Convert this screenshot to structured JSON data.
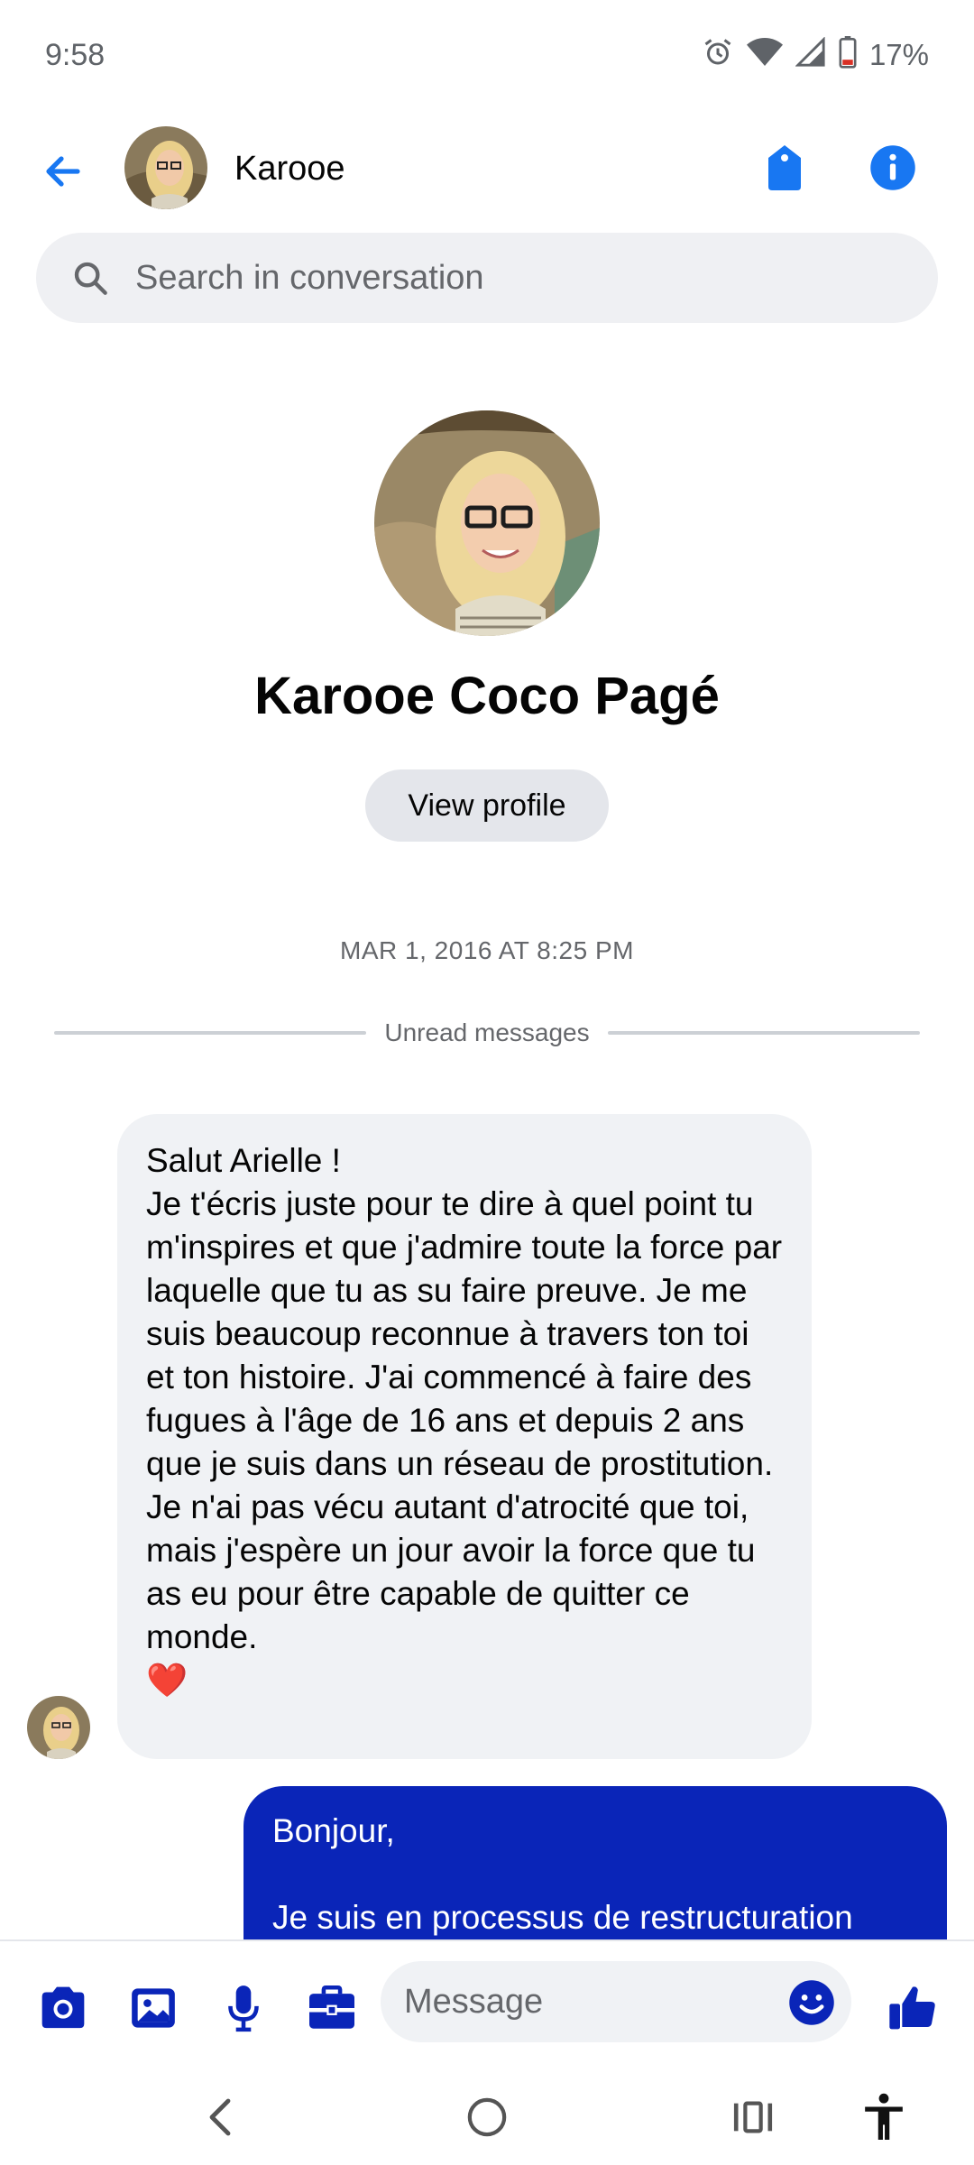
{
  "status": {
    "time": "9:58",
    "battery": "17%",
    "icons": [
      "alarm-icon",
      "wifi-icon",
      "signal-icon",
      "battery-icon"
    ]
  },
  "header": {
    "name": "Karooe",
    "icons": [
      "back-arrow-icon",
      "tag-icon",
      "info-icon"
    ]
  },
  "search": {
    "placeholder": "Search in conversation"
  },
  "profile": {
    "name": "Karooe Coco Pagé",
    "view_profile_label": "View profile"
  },
  "thread": {
    "timestamp": "MAR 1, 2016 AT 8:25 PM",
    "unread_label": "Unread messages",
    "messages": [
      {
        "direction": "incoming",
        "text": "Salut Arielle !\nJe t'écris juste pour te dire à quel point tu m'inspires et que j'admire toute la force par laquelle que tu as su faire preuve. Je me suis beaucoup reconnue à travers ton toi et ton histoire. J'ai commencé à faire des fugues à l'âge de 16 ans et depuis 2 ans que je suis dans un réseau de prostitution. Je n'ai pas vécu autant d'atrocité que toi, mais j'espère un jour avoir la force que tu as eu pour être capable de quitter ce monde.",
        "emoji": "❤️"
      },
      {
        "direction": "outgoing",
        "text": "Bonjour,\n\nJe suis en processus de restructuration"
      }
    ]
  },
  "composer": {
    "placeholder": "Message",
    "icons": [
      "camera-icon",
      "gallery-icon",
      "microphone-icon",
      "briefcase-icon",
      "emoji-icon",
      "thumbs-up-icon"
    ]
  },
  "colors": {
    "accent": "#0a25b8",
    "link_blue": "#1877f2",
    "incoming_bubble": "#f0f2f5",
    "muted_text": "#65676b"
  }
}
